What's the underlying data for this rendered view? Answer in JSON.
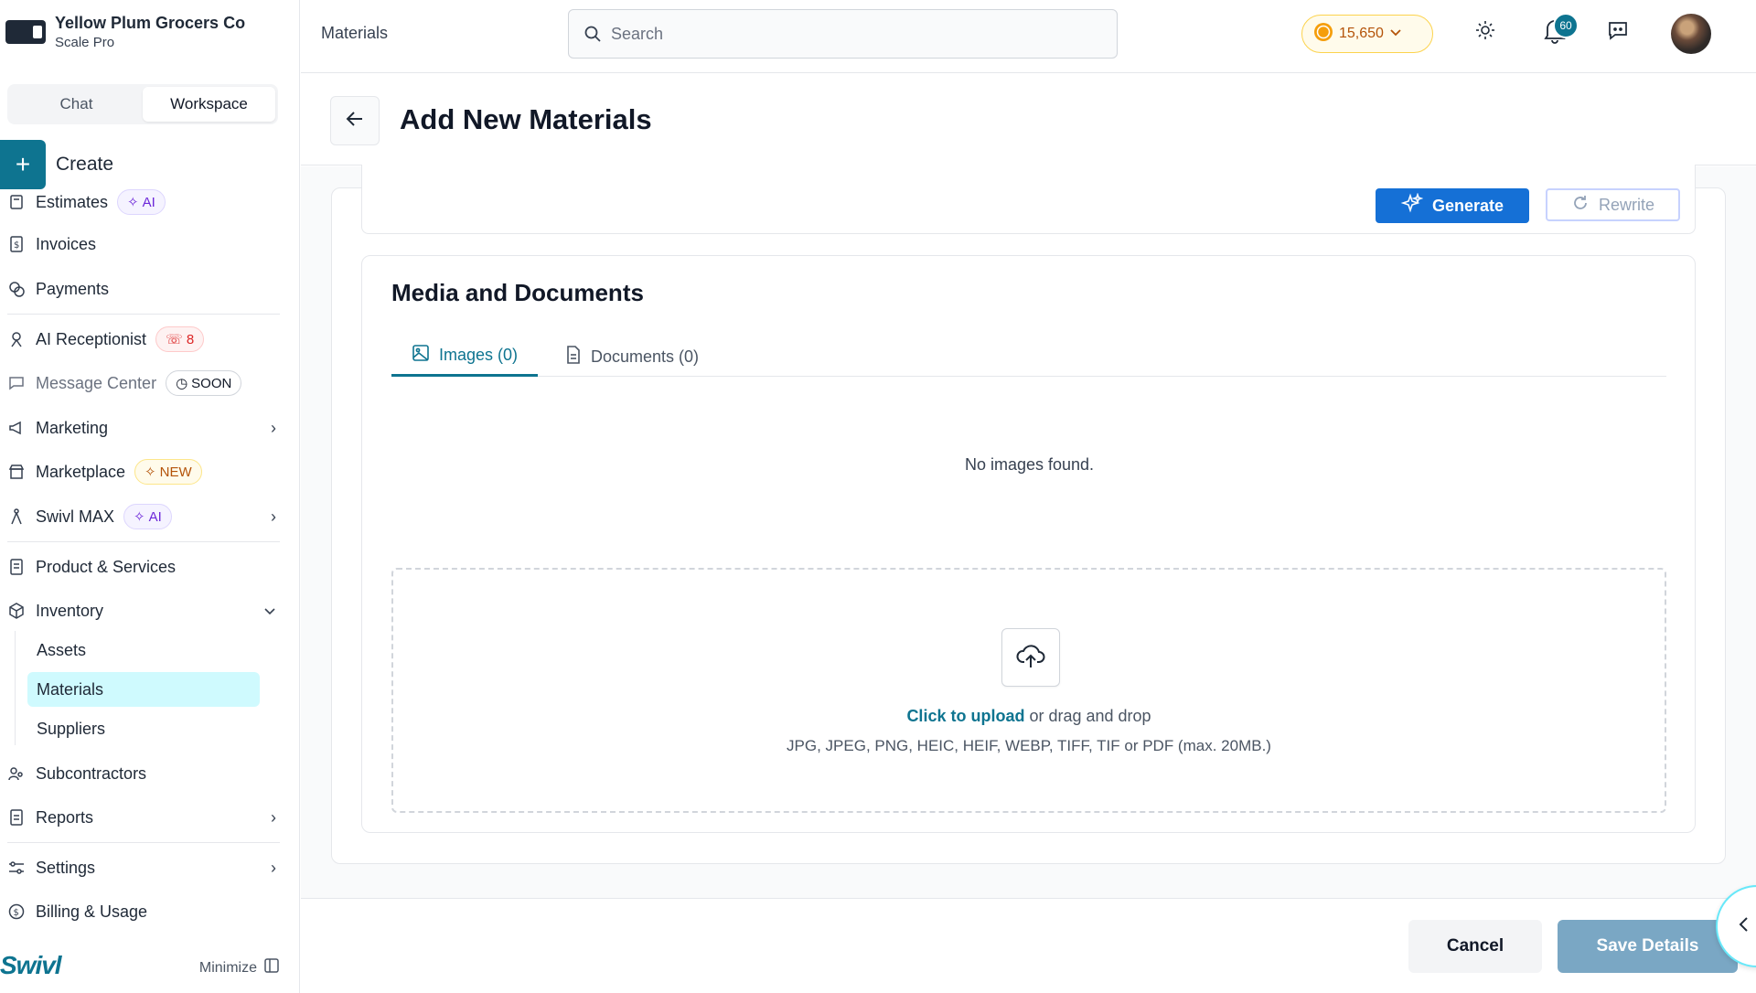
{
  "org": {
    "name": "Yellow Plum Grocers Co",
    "plan": "Scale Pro"
  },
  "mode_tabs": [
    {
      "label": "Chat"
    },
    {
      "label": "Workspace"
    }
  ],
  "create_label": "Create",
  "nav": {
    "estimates": {
      "label": "Estimates",
      "badge": "AI"
    },
    "invoices": {
      "label": "Invoices"
    },
    "payments": {
      "label": "Payments"
    },
    "ai_receptionist": {
      "label": "AI Receptionist",
      "badge": "8"
    },
    "message_center": {
      "label": "Message Center",
      "badge": "SOON"
    },
    "marketing": {
      "label": "Marketing"
    },
    "marketplace": {
      "label": "Marketplace",
      "badge": "NEW"
    },
    "swivl_max": {
      "label": "Swivl MAX",
      "badge": "AI"
    },
    "products": {
      "label": "Product & Services"
    },
    "inventory": {
      "label": "Inventory",
      "children": [
        {
          "label": "Assets"
        },
        {
          "label": "Materials"
        },
        {
          "label": "Suppliers"
        }
      ]
    },
    "subcontractors": {
      "label": "Subcontractors"
    },
    "reports": {
      "label": "Reports"
    },
    "settings": {
      "label": "Settings"
    },
    "billing": {
      "label": "Billing & Usage"
    }
  },
  "brand": "Swivl",
  "minimize_label": "Minimize",
  "topbar": {
    "breadcrumb": "Materials",
    "search_placeholder": "Search",
    "coins": "15,650",
    "notification_count": "60"
  },
  "page": {
    "title": "Add New Materials"
  },
  "ai_actions": {
    "generate": "Generate",
    "rewrite": "Rewrite"
  },
  "media": {
    "title": "Media and Documents",
    "tabs": [
      {
        "label": "Images (0)"
      },
      {
        "label": "Documents (0)"
      }
    ],
    "empty_text": "No images found.",
    "upload_link": "Click to upload",
    "upload_rest": "or drag and drop",
    "upload_types": "JPG, JPEG, PNG, HEIC, HEIF, WEBP, TIFF, TIF or PDF (max. 20MB.)"
  },
  "footer": {
    "cancel": "Cancel",
    "save": "Save Details"
  },
  "colors": {
    "accent": "#0e7490",
    "generate": "#1570d6",
    "active_nav_bg": "#cffafe"
  }
}
